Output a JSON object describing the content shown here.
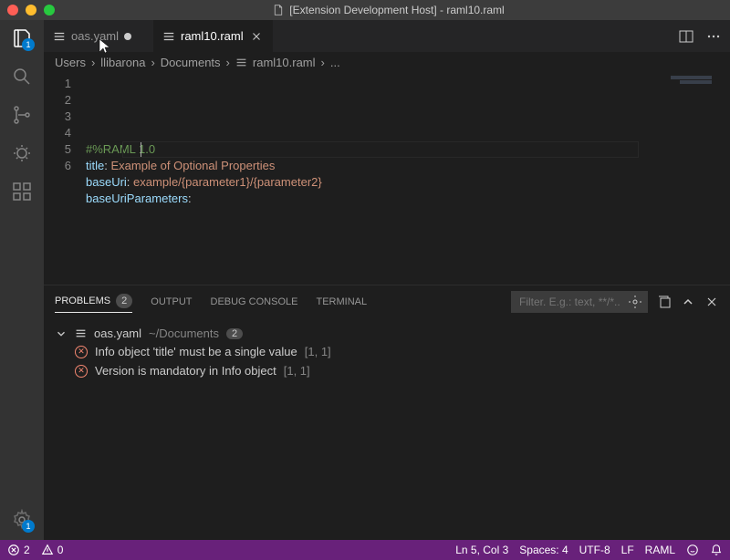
{
  "titlebar": {
    "title": "[Extension Development Host] - raml10.raml"
  },
  "activity": {
    "explorer_badge": "1",
    "settings_badge": "1"
  },
  "tabs": [
    {
      "label": "oas.yaml",
      "dirty": true,
      "active": false
    },
    {
      "label": "raml10.raml",
      "dirty": false,
      "active": true
    }
  ],
  "breadcrumb": {
    "parts": [
      "Users",
      "llibarona",
      "Documents",
      "raml10.raml",
      "..."
    ]
  },
  "editor": {
    "lines": [
      {
        "n": "1",
        "segments": [
          {
            "cls": "tok-comment",
            "t": "#%RAML 1.0"
          }
        ]
      },
      {
        "n": "2",
        "segments": [
          {
            "cls": "tok-key",
            "t": "title"
          },
          {
            "cls": "tok-plain",
            "t": ": "
          },
          {
            "cls": "tok-string",
            "t": "Example of Optional Properties"
          }
        ]
      },
      {
        "n": "3",
        "segments": [
          {
            "cls": "tok-key",
            "t": "baseUri"
          },
          {
            "cls": "tok-plain",
            "t": ": "
          },
          {
            "cls": "tok-string",
            "t": "example/{parameter1}/{parameter2}"
          }
        ]
      },
      {
        "n": "4",
        "segments": [
          {
            "cls": "tok-key",
            "t": "baseUriParameters"
          },
          {
            "cls": "tok-plain",
            "t": ":"
          }
        ]
      },
      {
        "n": "5",
        "segments": [
          {
            "cls": "tok-plain",
            "t": "  "
          }
        ]
      },
      {
        "n": "6",
        "segments": []
      }
    ]
  },
  "panel": {
    "tabs": {
      "problems": "Problems",
      "problems_count": "2",
      "output": "Output",
      "debug": "Debug Console",
      "terminal": "Terminal"
    },
    "filter_placeholder": "Filter. E.g.: text, **/*...",
    "file": {
      "name": "oas.yaml",
      "path": "~/Documents",
      "count": "2"
    },
    "items": [
      {
        "msg": "Info object 'title' must be a single value",
        "loc": "[1, 1]"
      },
      {
        "msg": "Version is mandatory in Info object",
        "loc": "[1, 1]"
      }
    ]
  },
  "status": {
    "errors": "2",
    "warnings": "0",
    "ln_col": "Ln 5, Col 3",
    "spaces": "Spaces: 4",
    "encoding": "UTF-8",
    "eol": "LF",
    "language": "RAML"
  }
}
